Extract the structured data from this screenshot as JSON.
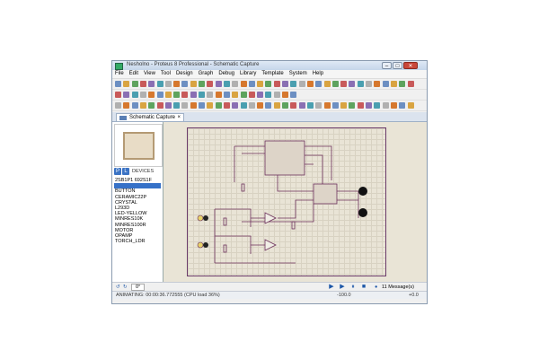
{
  "window": {
    "title": "Nesholno - Proteus 8 Professional - Schematic Capture",
    "controls": {
      "minimize": "–",
      "maximize": "□",
      "close": "✕"
    }
  },
  "menu": [
    "File",
    "Edit",
    "View",
    "Tool",
    "Design",
    "Graph",
    "Debug",
    "Library",
    "Template",
    "System",
    "Help"
  ],
  "tab": {
    "label": "Schematic Capture",
    "close": "×"
  },
  "left_panel": {
    "mode_buttons": [
      "P",
      "L"
    ],
    "devices_header": "DEVICES",
    "devices": [
      "2SB1P1 692S1F",
      "",
      "BUTTON",
      "CERAMIC22P",
      "CRYSTAL",
      "L293D",
      "LED-YELLOW",
      "MINRES10K",
      "MINRES100R",
      "MOTOR",
      "OPAMP",
      "TORCH_LDR"
    ],
    "selected_index": 1
  },
  "rotation": {
    "value": "0°"
  },
  "sim": {
    "play": "▶",
    "step": "▶",
    "pause": "⏸",
    "stop": "■"
  },
  "messages": "11 Message(s)",
  "coords": {
    "x": "-100.0",
    "y": "+0.0"
  },
  "status": {
    "animating": "ANIMATING: 00:00:36.772555 (CPU load 36%)"
  },
  "colors": {
    "accent": "#3571c8",
    "wire": "#6b2f5a",
    "sheet_border": "#6b3b6b"
  }
}
